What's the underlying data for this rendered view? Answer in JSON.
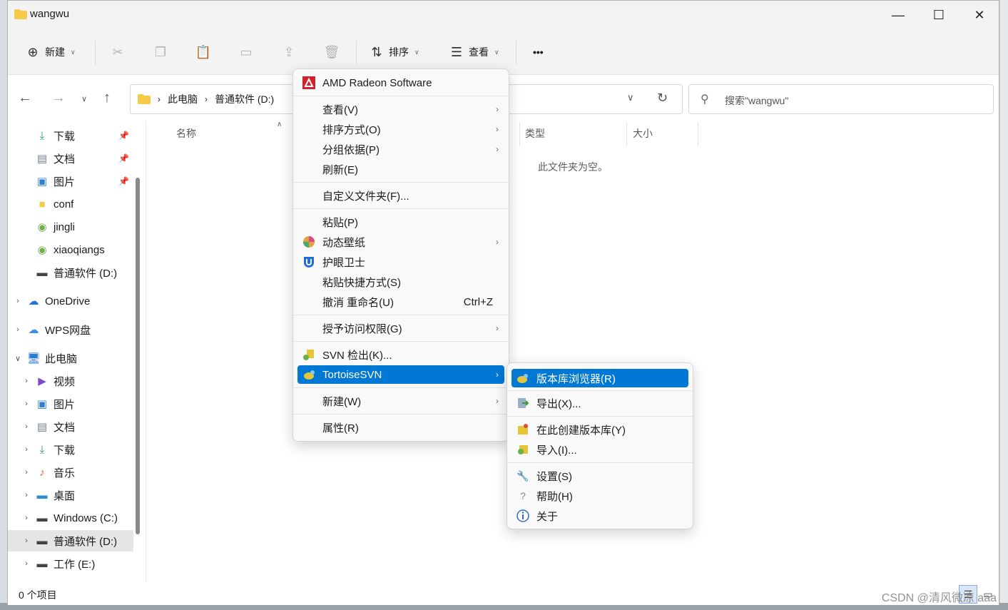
{
  "window": {
    "title": "wangwu"
  },
  "toolbar": {
    "new_label": "新建",
    "sort_label": "排序",
    "view_label": "查看",
    "more_label": "•••"
  },
  "address": {
    "crumbs": [
      "此电脑",
      "普通软件 (D:)"
    ],
    "search_placeholder": "搜索\"wangwu\""
  },
  "sidebar": {
    "quick": [
      {
        "label": "下载"
      },
      {
        "label": "文档"
      },
      {
        "label": "图片"
      },
      {
        "label": "conf"
      },
      {
        "label": "jingli"
      },
      {
        "label": "xiaoqiangs"
      },
      {
        "label": "普通软件 (D:)"
      }
    ],
    "onedrive": "OneDrive",
    "wps": "WPS网盘",
    "thispc": "此电脑",
    "pc_items": [
      {
        "label": "视频"
      },
      {
        "label": "图片"
      },
      {
        "label": "文档"
      },
      {
        "label": "下载"
      },
      {
        "label": "音乐"
      },
      {
        "label": "桌面"
      },
      {
        "label": "Windows (C:)"
      },
      {
        "label": "普通软件 (D:)"
      },
      {
        "label": "工作 (E:)"
      }
    ]
  },
  "columns": {
    "name": "名称",
    "type": "类型",
    "size": "大小"
  },
  "content": {
    "empty": "此文件夹为空。"
  },
  "status": {
    "count": "0 个项目"
  },
  "context_menu": {
    "amd": "AMD Radeon Software",
    "view": "查看(V)",
    "sort": "排序方式(O)",
    "group": "分组依据(P)",
    "refresh": "刷新(E)",
    "customize": "自定义文件夹(F)...",
    "paste": "粘贴(P)",
    "wallpaper": "动态壁纸",
    "eyecare": "护眼卫士",
    "paste_shortcut": "粘贴快捷方式(S)",
    "undo": "撤消 重命名(U)",
    "undo_shortcut": "Ctrl+Z",
    "access": "授予访问权限(G)",
    "svn_checkout": "SVN 检出(K)...",
    "tortoise": "TortoiseSVN",
    "new": "新建(W)",
    "properties": "属性(R)"
  },
  "submenu": {
    "repo_browser": "版本库浏览器(R)",
    "export": "导出(X)...",
    "create_repo": "在此创建版本库(Y)",
    "import": "导入(I)...",
    "settings": "设置(S)",
    "help": "帮助(H)",
    "about": "关于"
  },
  "watermark": "CSDN @清风微凉 aaa",
  "colors": {
    "accent": "#0078d4",
    "folder": "#f7c948"
  }
}
